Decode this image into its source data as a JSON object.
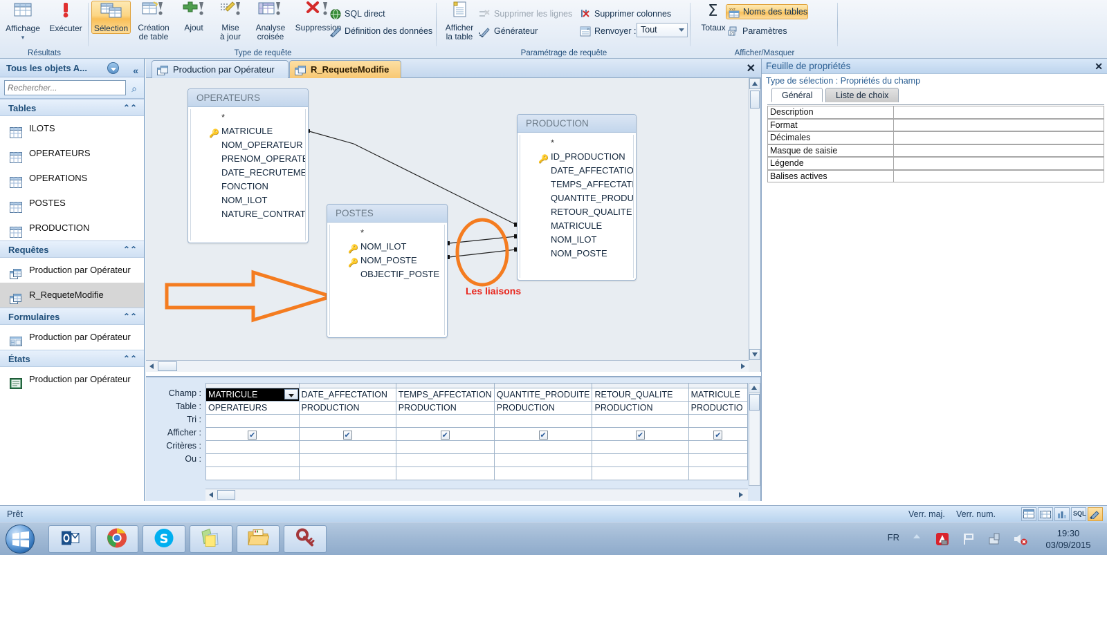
{
  "ribbon": {
    "groups": [
      {
        "title": "Résultats"
      },
      {
        "title": "Type de requête"
      },
      {
        "title": "Paramétrage de requête"
      },
      {
        "title": "Afficher/Masquer"
      }
    ],
    "results": [
      {
        "label1": "Affichage",
        "label2": "",
        "icon": "datasheet-view-icon",
        "caret": true
      },
      {
        "label1": "Exécuter",
        "label2": "",
        "icon": "run-exclamation-icon",
        "caret": false
      }
    ],
    "query_types": [
      {
        "label1": "Sélection",
        "label2": "",
        "icon": "select-query-icon",
        "selected": true
      },
      {
        "label1": "Création",
        "label2": "de table",
        "icon": "make-table-query-icon",
        "selected": false
      },
      {
        "label1": "Ajout",
        "label2": "",
        "icon": "append-query-icon",
        "selected": false
      },
      {
        "label1": "Mise",
        "label2": "à jour",
        "icon": "update-query-icon",
        "selected": false
      },
      {
        "label1": "Analyse",
        "label2": "croisée",
        "icon": "crosstab-query-icon",
        "selected": false
      },
      {
        "label1": "Suppression",
        "label2": "",
        "icon": "delete-query-icon",
        "selected": false
      }
    ],
    "query_types_small": [
      {
        "label": "SQL direct",
        "icon": "globe-icon",
        "disabled": false
      },
      {
        "label": "Définition des données",
        "icon": "data-definition-icon",
        "disabled": false
      }
    ],
    "query_setup": {
      "show_table": {
        "label1": "Afficher",
        "label2": "la table",
        "icon": "show-table-icon"
      },
      "items": [
        {
          "label": "Supprimer les lignes",
          "icon": "delete-rows-icon",
          "disabled": true
        },
        {
          "label": "Supprimer colonnes",
          "icon": "delete-columns-icon",
          "disabled": false
        },
        {
          "label": "Générateur",
          "icon": "builder-wand-icon",
          "disabled": false
        },
        {
          "label": "Renvoyer :",
          "icon": "return-rows-icon",
          "disabled": false
        }
      ],
      "return_value": "Tout"
    },
    "show_hide": {
      "totals": {
        "label": "Totaux",
        "icon": "sigma-icon"
      },
      "items": [
        {
          "label": "Noms des tables",
          "icon": "table-names-icon",
          "selected": true
        },
        {
          "label": "Paramètres",
          "icon": "parameters-icon",
          "selected": false
        }
      ]
    }
  },
  "navpane": {
    "title": "Tous les objets A...",
    "search_placeholder": "Rechercher...",
    "sections": [
      {
        "title": "Tables",
        "items": [
          {
            "label": "ILOTS",
            "icon": "table-icon",
            "selected": false
          },
          {
            "label": "OPERATEURS",
            "icon": "table-icon",
            "selected": false
          },
          {
            "label": "OPERATIONS",
            "icon": "table-icon",
            "selected": false
          },
          {
            "label": "POSTES",
            "icon": "table-icon",
            "selected": false
          },
          {
            "label": "PRODUCTION",
            "icon": "table-icon",
            "selected": false
          }
        ]
      },
      {
        "title": "Requêtes",
        "items": [
          {
            "label": "Production par Opérateur",
            "icon": "query-icon",
            "selected": false
          },
          {
            "label": "R_RequeteModifie",
            "icon": "query-icon",
            "selected": true
          }
        ]
      },
      {
        "title": "Formulaires",
        "items": [
          {
            "label": "Production par Opérateur",
            "icon": "form-icon",
            "selected": false
          }
        ]
      },
      {
        "title": "États",
        "items": [
          {
            "label": "Production par Opérateur",
            "icon": "report-icon",
            "selected": false
          }
        ]
      }
    ]
  },
  "doctabs": [
    {
      "label": "Production par Opérateur",
      "active": false,
      "icon": "query-icon"
    },
    {
      "label": "R_RequeteModifie",
      "active": true,
      "icon": "query-icon"
    }
  ],
  "design": {
    "tables": [
      {
        "name": "OPERATEURS",
        "fields": [
          "*",
          "MATRICULE",
          "NOM_OPERATEUR",
          "PRENOM_OPERATEUR",
          "DATE_RECRUTEMENT",
          "FONCTION",
          "NOM_ILOT",
          "NATURE_CONTRAT"
        ],
        "keys": [
          "MATRICULE"
        ]
      },
      {
        "name": "POSTES",
        "fields": [
          "*",
          "NOM_ILOT",
          "NOM_POSTE",
          "OBJECTIF_POSTE"
        ],
        "keys": [
          "NOM_ILOT",
          "NOM_POSTE"
        ]
      },
      {
        "name": "PRODUCTION",
        "fields": [
          "*",
          "ID_PRODUCTION",
          "DATE_AFFECTATION",
          "TEMPS_AFFECTATION",
          "QUANTITE_PRODUITE",
          "RETOUR_QUALITE",
          "MATRICULE",
          "NOM_ILOT",
          "NOM_POSTE"
        ],
        "keys": [
          "ID_PRODUCTION"
        ]
      }
    ],
    "annotation": {
      "label": "Les liaisons",
      "label_color": "#e8241b",
      "highlight_color": "#f47c20",
      "arrow_color": "#f47c20"
    }
  },
  "query_grid": {
    "row_labels": [
      "Champ :",
      "Table :",
      "Tri :",
      "Afficher :",
      "Critères :",
      "Ou :"
    ],
    "columns": [
      {
        "field": "MATRICULE",
        "table": "OPERATEURS",
        "tri": "",
        "afficher": true,
        "criteres": "",
        "ou": "",
        "selected": true
      },
      {
        "field": "DATE_AFFECTATION",
        "table": "PRODUCTION",
        "tri": "",
        "afficher": true,
        "criteres": "",
        "ou": "",
        "selected": false
      },
      {
        "field": "TEMPS_AFFECTATION",
        "table": "PRODUCTION",
        "tri": "",
        "afficher": true,
        "criteres": "",
        "ou": "",
        "selected": false
      },
      {
        "field": "QUANTITE_PRODUITE",
        "table": "PRODUCTION",
        "tri": "",
        "afficher": true,
        "criteres": "",
        "ou": "",
        "selected": false
      },
      {
        "field": "RETOUR_QUALITE",
        "table": "PRODUCTION",
        "tri": "",
        "afficher": true,
        "criteres": "",
        "ou": "",
        "selected": false
      },
      {
        "field": "MATRICULE",
        "table": "PRODUCTIO",
        "tri": "",
        "afficher": true,
        "criteres": "",
        "ou": "",
        "selected": false
      }
    ],
    "check_glyph": "✔"
  },
  "property_sheet": {
    "title": "Feuille de propriétés",
    "subtitle": "Type de sélection :  Propriétés du champ",
    "tabs": [
      {
        "label": "Général",
        "active": true
      },
      {
        "label": "Liste de choix",
        "active": false
      }
    ],
    "rows": [
      {
        "name": "Description",
        "value": ""
      },
      {
        "name": "Format",
        "value": ""
      },
      {
        "name": "Décimales",
        "value": ""
      },
      {
        "name": "Masque de saisie",
        "value": ""
      },
      {
        "name": "Légende",
        "value": ""
      },
      {
        "name": "Balises actives",
        "value": ""
      }
    ]
  },
  "statusbar": {
    "message": "Prêt",
    "indicators": [
      "Verr. maj.",
      "Verr. num."
    ],
    "view_buttons": [
      {
        "name": "datasheet-view-button",
        "label": "",
        "active": false
      },
      {
        "name": "pivottable-view-button",
        "label": "",
        "active": false
      },
      {
        "name": "pivotchart-view-button",
        "label": "",
        "active": false
      },
      {
        "name": "sql-view-button",
        "label": "SQL",
        "active": false
      },
      {
        "name": "design-view-button",
        "label": "",
        "active": true
      }
    ]
  },
  "taskbar": {
    "buttons": [
      {
        "name": "outlook-taskbar-button",
        "icon": "outlook-icon"
      },
      {
        "name": "chrome-taskbar-button",
        "icon": "chrome-icon"
      },
      {
        "name": "skype-taskbar-button",
        "icon": "skype-icon"
      },
      {
        "name": "sticky-notes-taskbar-button",
        "icon": "sticky-notes-icon"
      },
      {
        "name": "explorer-taskbar-button",
        "icon": "folder-icon"
      },
      {
        "name": "access-taskbar-button",
        "icon": "access-key-icon"
      }
    ],
    "language": "FR",
    "time": "19:30",
    "date": "03/09/2015"
  }
}
